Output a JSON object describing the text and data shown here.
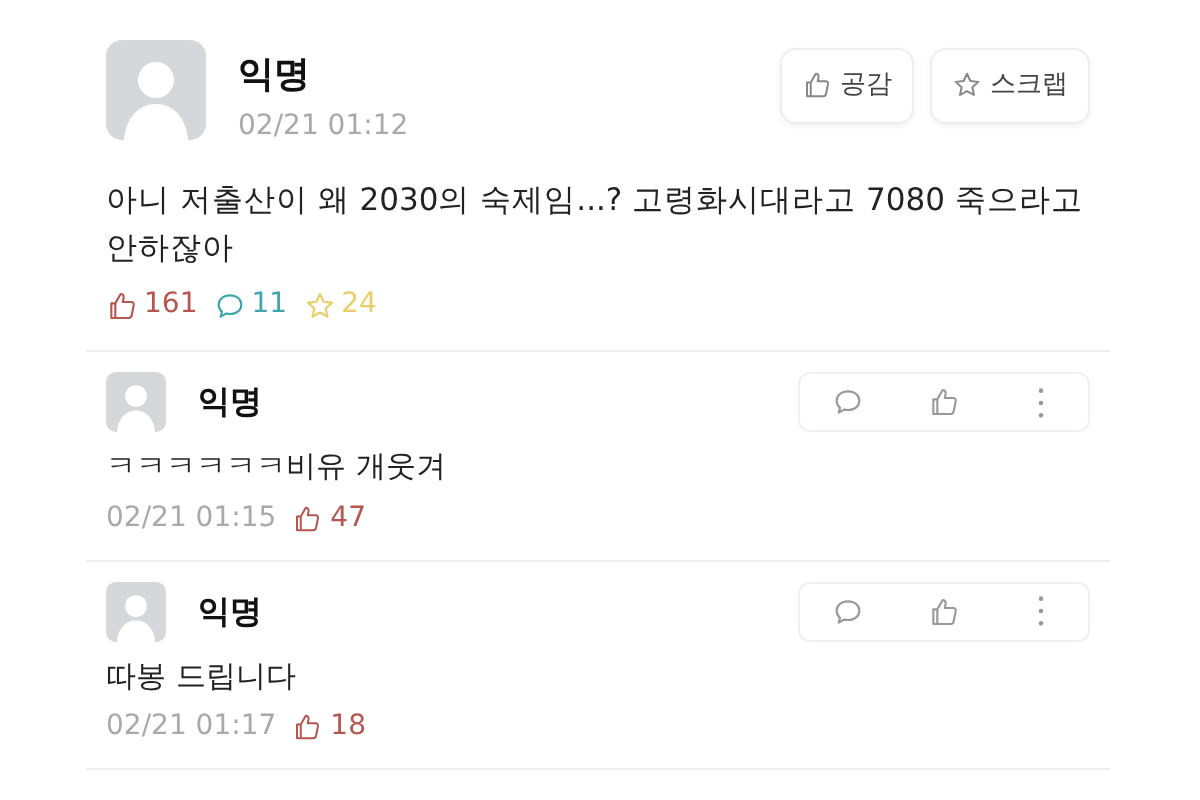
{
  "post": {
    "author": "익명",
    "date": "02/21 01:12",
    "body": "아니 저출산이 왜 2030의 숙제임...? 고령화시대라고 7080 죽으라고 안하잖아",
    "buttons": [
      {
        "label": "공감",
        "kind": "like"
      },
      {
        "label": "스크랩",
        "kind": "scrap"
      }
    ],
    "stats": [
      {
        "kind": "like",
        "count": "161",
        "color": "#b5574f"
      },
      {
        "kind": "comment",
        "count": "11",
        "color": "#3fa6ad"
      },
      {
        "kind": "scrap",
        "count": "24",
        "color": "#e9cf6a"
      }
    ]
  },
  "comments": [
    {
      "author": "익명",
      "body": "ㅋㅋㅋㅋㅋㅋ비유 개웃겨",
      "date": "02/21 01:15",
      "likes": "47"
    },
    {
      "author": "익명",
      "body": "따봉 드립니다",
      "date": "02/21 01:17",
      "likes": "18"
    }
  ]
}
